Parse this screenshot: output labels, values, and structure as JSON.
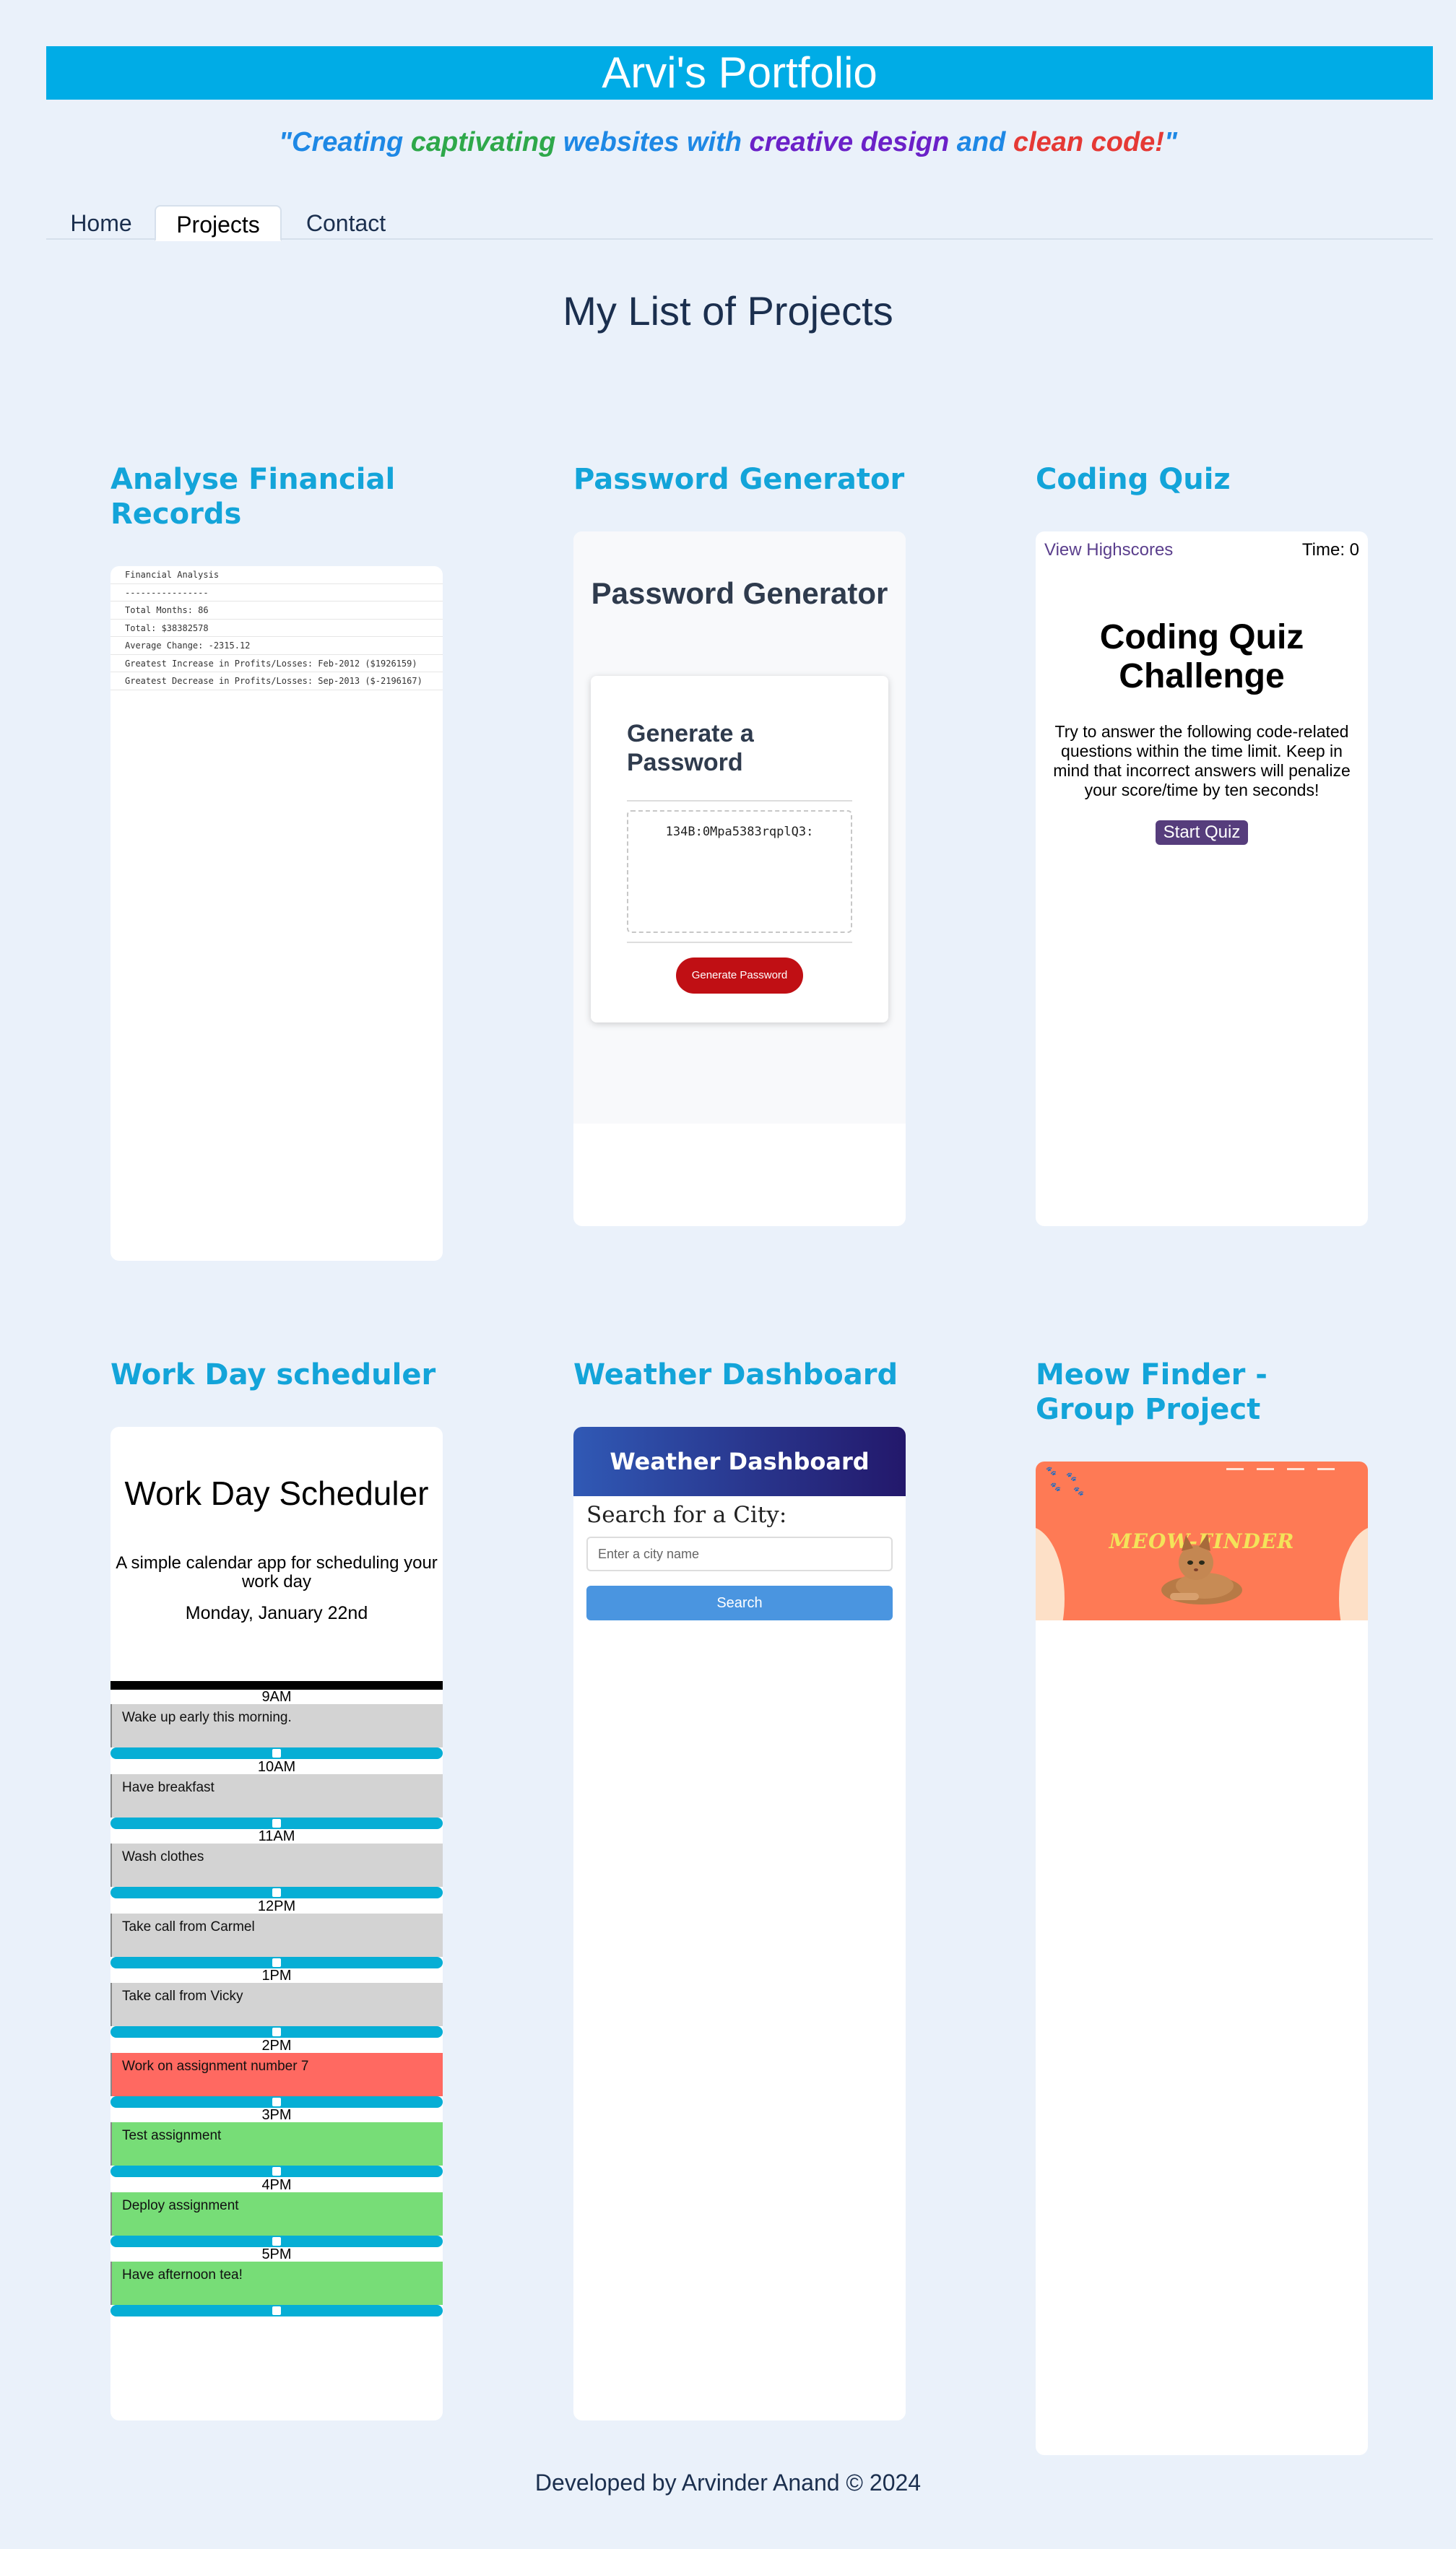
{
  "header": {
    "title": "Arvi's Portfolio"
  },
  "tagline": [
    {
      "text": "\"Creating ",
      "color": "#1e88e5"
    },
    {
      "text": "captivating ",
      "color": "#2ea84a"
    },
    {
      "text": "websites with ",
      "color": "#1e88e5"
    },
    {
      "text": "creative design ",
      "color": "#6b21c8"
    },
    {
      "text": "and ",
      "color": "#1e88e5"
    },
    {
      "text": "clean code",
      "color": "#e53935"
    },
    {
      "text": "!",
      "color": "#e53935"
    },
    {
      "text": "\"",
      "color": "#1e88e5"
    }
  ],
  "nav": {
    "items": [
      "Home",
      "Projects",
      "Contact"
    ],
    "active": "Projects"
  },
  "main": {
    "title": "My List of Projects"
  },
  "projects": {
    "financial": {
      "title": "Analyse Financial Records",
      "lines": [
        "Financial Analysis",
        "----------------",
        "Total Months: 86",
        "Total: $38382578",
        "Average Change: -2315.12",
        "Greatest Increase in Profits/Losses: Feb-2012 ($1926159)",
        "Greatest Decrease in Profits/Losses: Sep-2013 ($-2196167)"
      ]
    },
    "password": {
      "title": "Password Generator",
      "app_title": "Password Generator",
      "card_title": "Generate a Password",
      "password_value": "134B:0Mpa5383rqplQ3:",
      "button": "Generate Password"
    },
    "quiz": {
      "title": "Coding Quiz",
      "highscores": "View Highscores",
      "time": "Time: 0",
      "heading": "Coding Quiz Challenge",
      "intro": "Try to answer the following code-related questions within the time limit. Keep in mind that incorrect answers will penalize your score/time by ten seconds!",
      "button": "Start Quiz"
    },
    "scheduler": {
      "title": "Work Day scheduler",
      "heading": "Work Day Scheduler",
      "subtitle": "A simple calendar app for scheduling your work day",
      "date": "Monday, January 22nd",
      "slots": [
        {
          "hour": "9AM",
          "task": "Wake up early this morning.",
          "state": "past",
          "color": "#d3d3d3"
        },
        {
          "hour": "10AM",
          "task": "Have breakfast",
          "state": "past",
          "color": "#d3d3d3"
        },
        {
          "hour": "11AM",
          "task": "Wash clothes",
          "state": "past",
          "color": "#d3d3d3"
        },
        {
          "hour": "12PM",
          "task": "Take call from Carmel",
          "state": "past",
          "color": "#d3d3d3"
        },
        {
          "hour": "1PM",
          "task": "Take call from Vicky",
          "state": "past",
          "color": "#d3d3d3"
        },
        {
          "hour": "2PM",
          "task": "Work on assignment number 7",
          "state": "present",
          "color": "#ff6961"
        },
        {
          "hour": "3PM",
          "task": "Test assignment",
          "state": "future",
          "color": "#77dd77"
        },
        {
          "hour": "4PM",
          "task": "Deploy assignment",
          "state": "future",
          "color": "#77dd77"
        },
        {
          "hour": "5PM",
          "task": "Have afternoon tea!",
          "state": "future",
          "color": "#77dd77"
        }
      ]
    },
    "weather": {
      "title": "Weather Dashboard",
      "app_title": "Weather Dashboard",
      "search_label": "Search for a City:",
      "placeholder": "Enter a city name",
      "button": "Search"
    },
    "meow": {
      "title": "Meow Finder - Group Project",
      "logo": "MEOW-FINDER"
    }
  },
  "footer": {
    "text": "Developed by Arvinder Anand © 2024"
  },
  "colors": {
    "accent": "#00ace6",
    "project_title": "#13a4d9",
    "background": "#eaf1fa"
  }
}
